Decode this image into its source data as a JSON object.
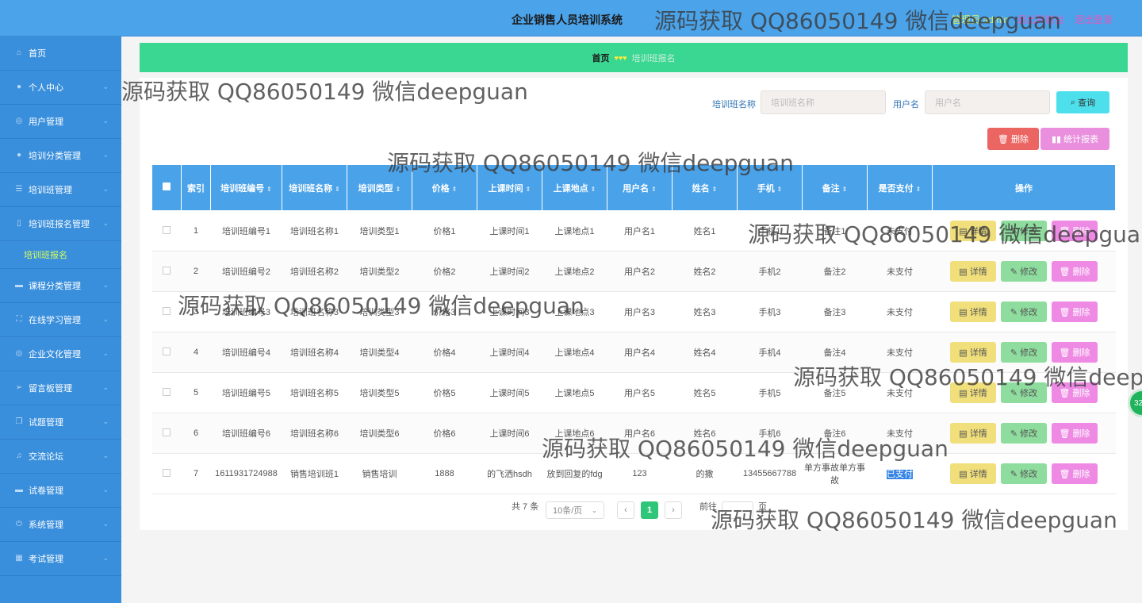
{
  "header": {
    "title": "企业销售人员培训系统",
    "role": "管理员 admin",
    "user_link": "退出到前台",
    "logout": "退出登录"
  },
  "sidebar": {
    "items": [
      {
        "label": "首页",
        "icon": "home-icon"
      },
      {
        "label": "个人中心",
        "icon": "user-icon"
      },
      {
        "label": "用户管理",
        "icon": "globe-icon"
      },
      {
        "label": "培训分类管理",
        "icon": "user-icon"
      },
      {
        "label": "培训班管理",
        "icon": "list-icon"
      },
      {
        "label": "培训班报名管理",
        "icon": "phone-icon"
      },
      {
        "label": "课程分类管理",
        "icon": "chat-icon"
      },
      {
        "label": "在线学习管理",
        "icon": "frame-icon"
      },
      {
        "label": "企业文化管理",
        "icon": "globe-icon"
      },
      {
        "label": "留言板管理",
        "icon": "send-icon"
      },
      {
        "label": "试题管理",
        "icon": "copy-icon"
      },
      {
        "label": "交流论坛",
        "icon": "mic-icon"
      },
      {
        "label": "试卷管理",
        "icon": "chat-icon"
      },
      {
        "label": "系统管理",
        "icon": "power-icon"
      },
      {
        "label": "考试管理",
        "icon": "grid-icon"
      }
    ],
    "sub_item": "培训班报名"
  },
  "breadcrumb": {
    "home": "首页",
    "current": "培训班报名"
  },
  "search": {
    "name_label": "培训班名称",
    "name_placeholder": "培训班名称",
    "user_label": "用户名",
    "user_placeholder": "用户名",
    "query_button": "查询"
  },
  "actions": {
    "delete": "删除",
    "report": "统计报表"
  },
  "table": {
    "headers": [
      "索引",
      "培训班编号",
      "培训班名称",
      "培训类型",
      "价格",
      "上课时间",
      "上课地点",
      "用户名",
      "姓名",
      "手机",
      "备注",
      "是否支付",
      "操作"
    ],
    "rows": [
      [
        "1",
        "培训班编号1",
        "培训班名称1",
        "培训类型1",
        "价格1",
        "上课时间1",
        "上课地点1",
        "用户名1",
        "姓名1",
        "手机1",
        "备注1",
        "未支付"
      ],
      [
        "2",
        "培训班编号2",
        "培训班名称2",
        "培训类型2",
        "价格2",
        "上课时间2",
        "上课地点2",
        "用户名2",
        "姓名2",
        "手机2",
        "备注2",
        "未支付"
      ],
      [
        "3",
        "培训班编号3",
        "培训班名称3",
        "培训类型3",
        "价格3",
        "上课时间3",
        "上课地点3",
        "用户名3",
        "姓名3",
        "手机3",
        "备注3",
        "未支付"
      ],
      [
        "4",
        "培训班编号4",
        "培训班名称4",
        "培训类型4",
        "价格4",
        "上课时间4",
        "上课地点4",
        "用户名4",
        "姓名4",
        "手机4",
        "备注4",
        "未支付"
      ],
      [
        "5",
        "培训班编号5",
        "培训班名称5",
        "培训类型5",
        "价格5",
        "上课时间5",
        "上课地点5",
        "用户名5",
        "姓名5",
        "手机5",
        "备注5",
        "未支付"
      ],
      [
        "6",
        "培训班编号6",
        "培训班名称6",
        "培训类型6",
        "价格6",
        "上课时间6",
        "上课地点6",
        "用户名6",
        "姓名6",
        "手机6",
        "备注6",
        "未支付"
      ],
      [
        "7",
        "1611931724988",
        "销售培训班1",
        "销售培训",
        "1888",
        "的飞洒hsdh",
        "放到回复的fdg",
        "123",
        "的撒",
        "13455667788",
        "单方事故单方事故",
        "已支付"
      ]
    ],
    "op_detail": "详情",
    "op_edit": "修改",
    "op_delete": "删除"
  },
  "pagination": {
    "total": "共 7 条",
    "page_size": "10条/页",
    "current_page": "1",
    "goto": "前往",
    "page_unit": "页"
  },
  "watermark": "源码获取 QQ86050149 微信deepguan",
  "floater": "32"
}
